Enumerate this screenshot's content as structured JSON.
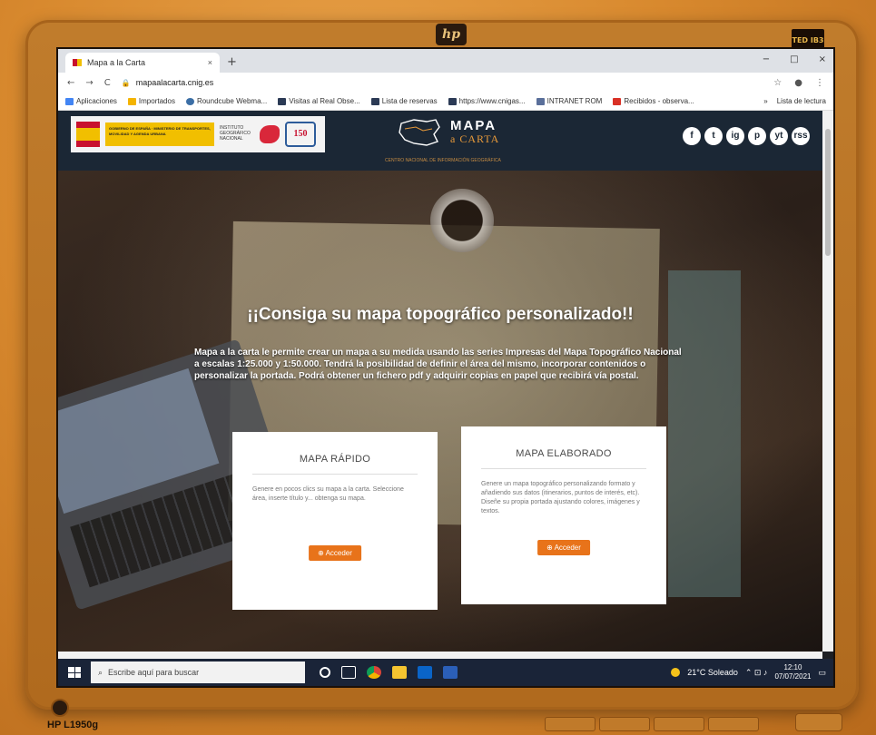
{
  "monitor": {
    "brand_logo": "hp",
    "model": "HP L1950g",
    "badge": "TED IB3"
  },
  "browser": {
    "tab_title": "Mapa a la Carta",
    "tab_close": "×",
    "new_tab": "+",
    "window_controls": [
      "−",
      "□",
      "×"
    ],
    "url": "mapaalacarta.cnig.es",
    "nav": [
      "←",
      "→",
      "C"
    ],
    "bookmarks": [
      "Aplicaciones",
      "Importados",
      "Roundcube Webma...",
      "Visitas al Real Obse...",
      "Lista de reservas",
      "https://www.cnigas...",
      "INTRANET ROM",
      "Recibidos - observa..."
    ],
    "bookmarks_right": [
      "»",
      "Lista de lectura"
    ]
  },
  "site": {
    "brand_name": "MAPA",
    "brand_sub": "a CARTA",
    "brand_tagline": "CENTRO NACIONAL DE INFORMACIÓN GEOGRÁFICA",
    "gov_text": "GOBIERNO DE ESPAÑA · MINISTERIO DE TRANSPORTES, MOVILIDAD Y AGENDA URBANA",
    "gov_ign": "INSTITUTO GEOGRÁFICO NACIONAL",
    "gov_anniv": "150",
    "social": [
      "f",
      "t",
      "ig",
      "p",
      "yt",
      "rss"
    ],
    "hero_title": "¡¡Consiga su mapa topográfico personalizado!!",
    "hero_desc": "Mapa a la carta le permite crear un mapa a su medida usando las series Impresas del Mapa Topográfico Nacional a escalas 1:25.000 y 1:50.000. Tendrá la posibilidad de definir el área del mismo, incorporar contenidos o personalizar la portada. Podrá obtener un fichero pdf y adquirir copias en papel que recibirá vía postal.",
    "cards": [
      {
        "title": "MAPA RÁPIDO",
        "text": "Genere en pocos clics su mapa a la carta. Seleccione área, inserte título y... obtenga su mapa.",
        "button": "⊕ Acceder"
      },
      {
        "title": "MAPA ELABORADO",
        "text": "Genere un mapa topográfico personalizando formato y añadiendo sus datos (itinerarios, puntos de interés, etc). Diseñe su propia portada ajustando colores, imágenes y textos.",
        "button": "⊕ Acceder"
      }
    ]
  },
  "taskbar": {
    "search_placeholder": "Escribe aquí para buscar",
    "weather": "21°C Soleado",
    "time": "12:10",
    "date": "07/07/2021"
  },
  "colors": {
    "accent": "#e8731a",
    "header": "#1b2735",
    "bezel": "#b06a1e"
  }
}
